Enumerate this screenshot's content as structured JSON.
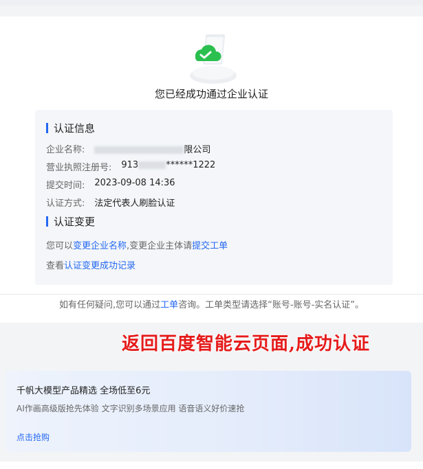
{
  "success": {
    "title": "您已经成功通过企业认证",
    "illustration": "cloud-check-illustration"
  },
  "cert_info": {
    "heading": "认证信息",
    "company_name": {
      "label": "企业名称:",
      "value_suffix": "限公司"
    },
    "license_no": {
      "label": "营业执照注册号:",
      "value_prefix": "913",
      "value_suffix": "******1222"
    },
    "submit_time": {
      "label": "提交时间:",
      "value": "2023-09-08 14:36"
    },
    "method": {
      "label": "认证方式:",
      "value": "法定代表人刷脸认证"
    }
  },
  "cert_change": {
    "heading": "认证变更",
    "line1_a": "您可以",
    "line1_link1": "变更企业名称",
    "line1_b": ",变更企业主体请",
    "line1_link2": "提交工单",
    "line2_a": "查看",
    "line2_link": "认证变更成功记录"
  },
  "help": {
    "a": "如有任何疑问,您可以通过",
    "link": "工单",
    "b": "咨询。工单类型请选择“账号-账号-实名认证”。"
  },
  "overlay": {
    "text": "返回百度智能云页面,成功认证"
  },
  "promo": {
    "title": "千帆大模型产品精选 全场低至6元",
    "subtitle": "AI作画高级版抢先体验 文字识别多场景应用 语音语义好价速抢",
    "cta": "点击抢购"
  },
  "colors": {
    "accent": "#2468f2",
    "overlay": "#e51b1b",
    "success": "#2bbf4f"
  }
}
